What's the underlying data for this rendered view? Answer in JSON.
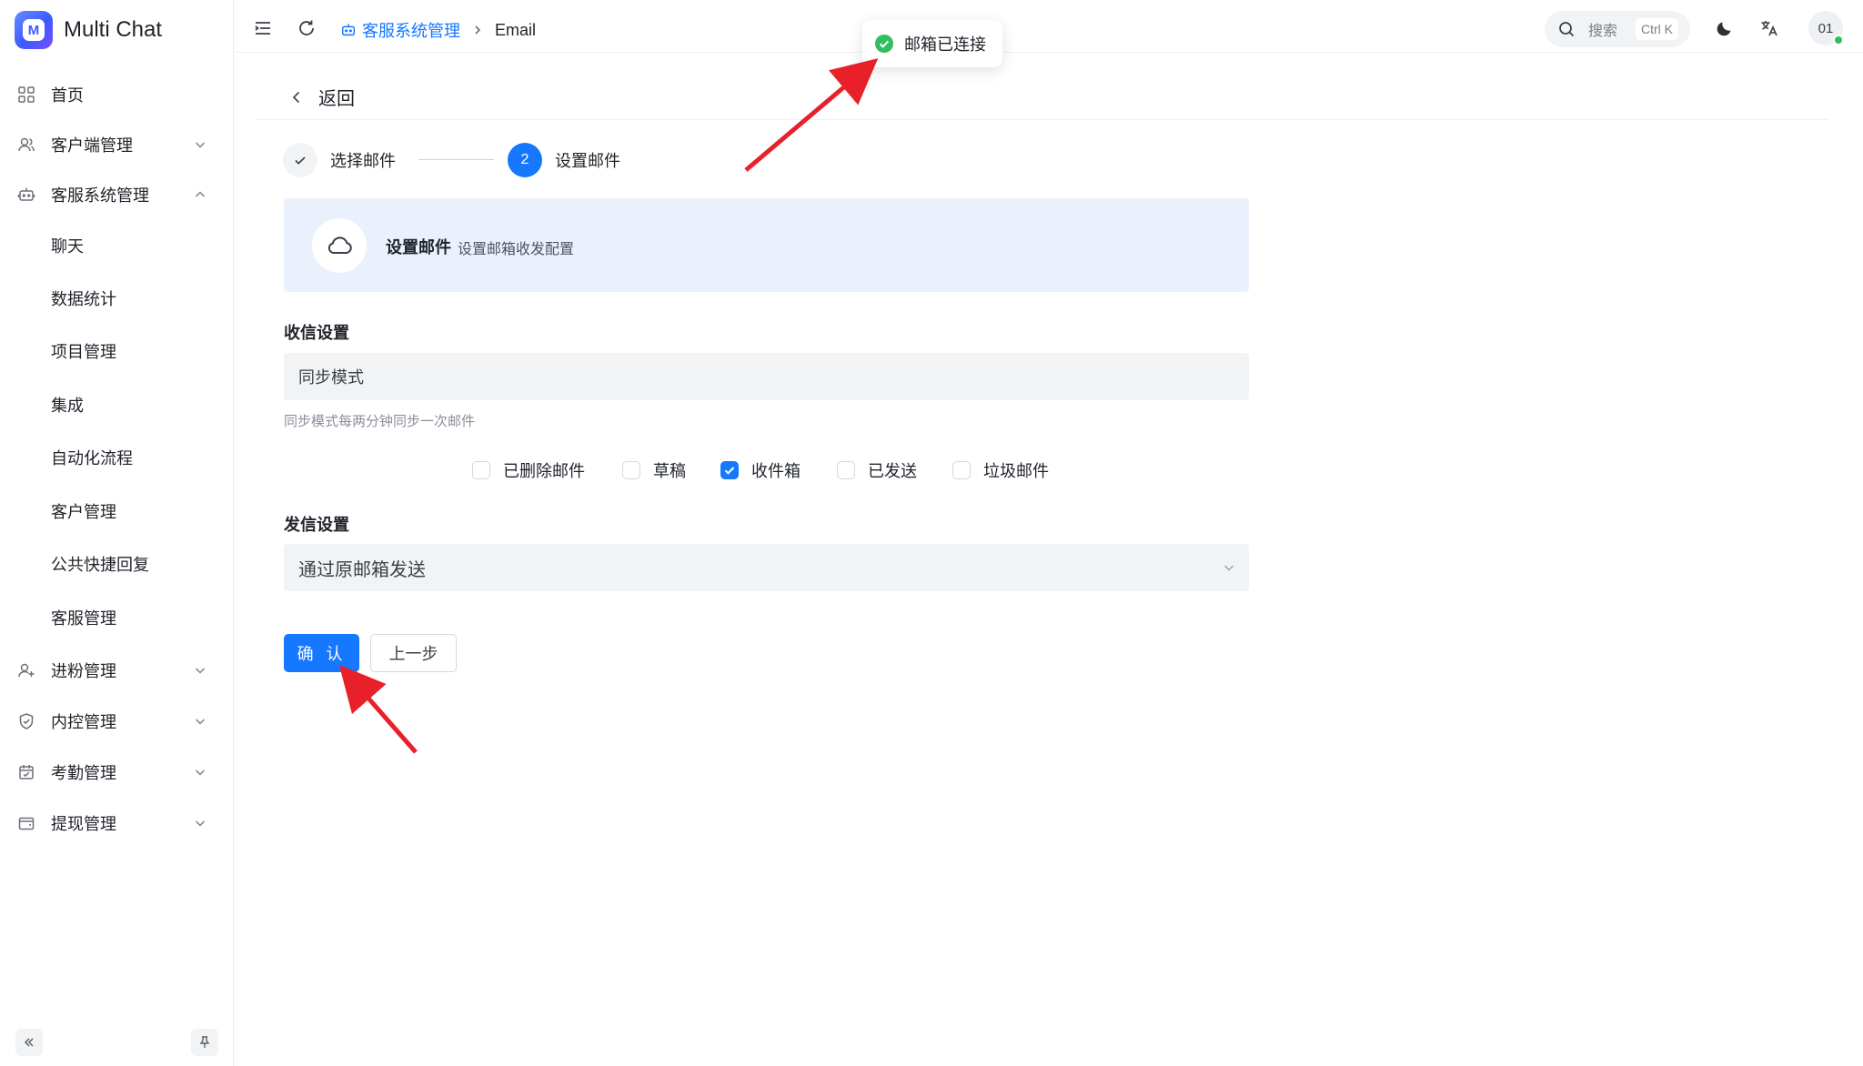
{
  "app": {
    "title": "Multi Chat",
    "logo_letter": "M"
  },
  "sidebar": {
    "items": [
      {
        "label": "首页",
        "icon": "grid-icon",
        "has_chevron": false
      },
      {
        "label": "客户端管理",
        "icon": "users-icon",
        "has_chevron": true,
        "expanded": false
      },
      {
        "label": "客服系统管理",
        "icon": "robot-icon",
        "has_chevron": true,
        "expanded": true
      },
      {
        "label": "进粉管理",
        "icon": "user-plus-icon",
        "has_chevron": true,
        "expanded": false
      },
      {
        "label": "内控管理",
        "icon": "shield-check-icon",
        "has_chevron": true,
        "expanded": false
      },
      {
        "label": "考勤管理",
        "icon": "calendar-check-icon",
        "has_chevron": true,
        "expanded": false
      },
      {
        "label": "提现管理",
        "icon": "wallet-icon",
        "has_chevron": true,
        "expanded": false
      }
    ],
    "sub_items": [
      "聊天",
      "数据统计",
      "项目管理",
      "集成",
      "自动化流程",
      "客户管理",
      "公共快捷回复",
      "客服管理"
    ]
  },
  "header": {
    "breadcrumb": {
      "parent": "客服系统管理",
      "current": "Email"
    },
    "search": {
      "placeholder": "搜索",
      "shortcut": "Ctrl K"
    },
    "avatar_text": "01"
  },
  "toast": {
    "message": "邮箱已连接",
    "type": "success"
  },
  "page": {
    "back_label": "返回",
    "steps": [
      {
        "number": "1",
        "label": "选择邮件",
        "status": "done"
      },
      {
        "number": "2",
        "label": "设置邮件",
        "status": "active"
      }
    ],
    "banner": {
      "title": "设置邮件",
      "description": "设置邮箱收发配置"
    },
    "receive": {
      "label": "收信设置",
      "mode_value": "同步模式",
      "hint": "同步模式每两分钟同步一次邮件",
      "folders": [
        {
          "label": "已删除邮件",
          "checked": false
        },
        {
          "label": "草稿",
          "checked": false
        },
        {
          "label": "收件箱",
          "checked": true
        },
        {
          "label": "已发送",
          "checked": false
        },
        {
          "label": "垃圾邮件",
          "checked": false
        }
      ]
    },
    "send": {
      "label": "发信设置",
      "selected_option": "通过原邮箱发送"
    },
    "buttons": {
      "confirm": "确 认",
      "previous": "上一步"
    }
  },
  "colors": {
    "primary": "#1677ff",
    "success": "#2fbf5f",
    "banner_bg": "#eaf1fd",
    "annotation_arrow": "#e8202a"
  }
}
